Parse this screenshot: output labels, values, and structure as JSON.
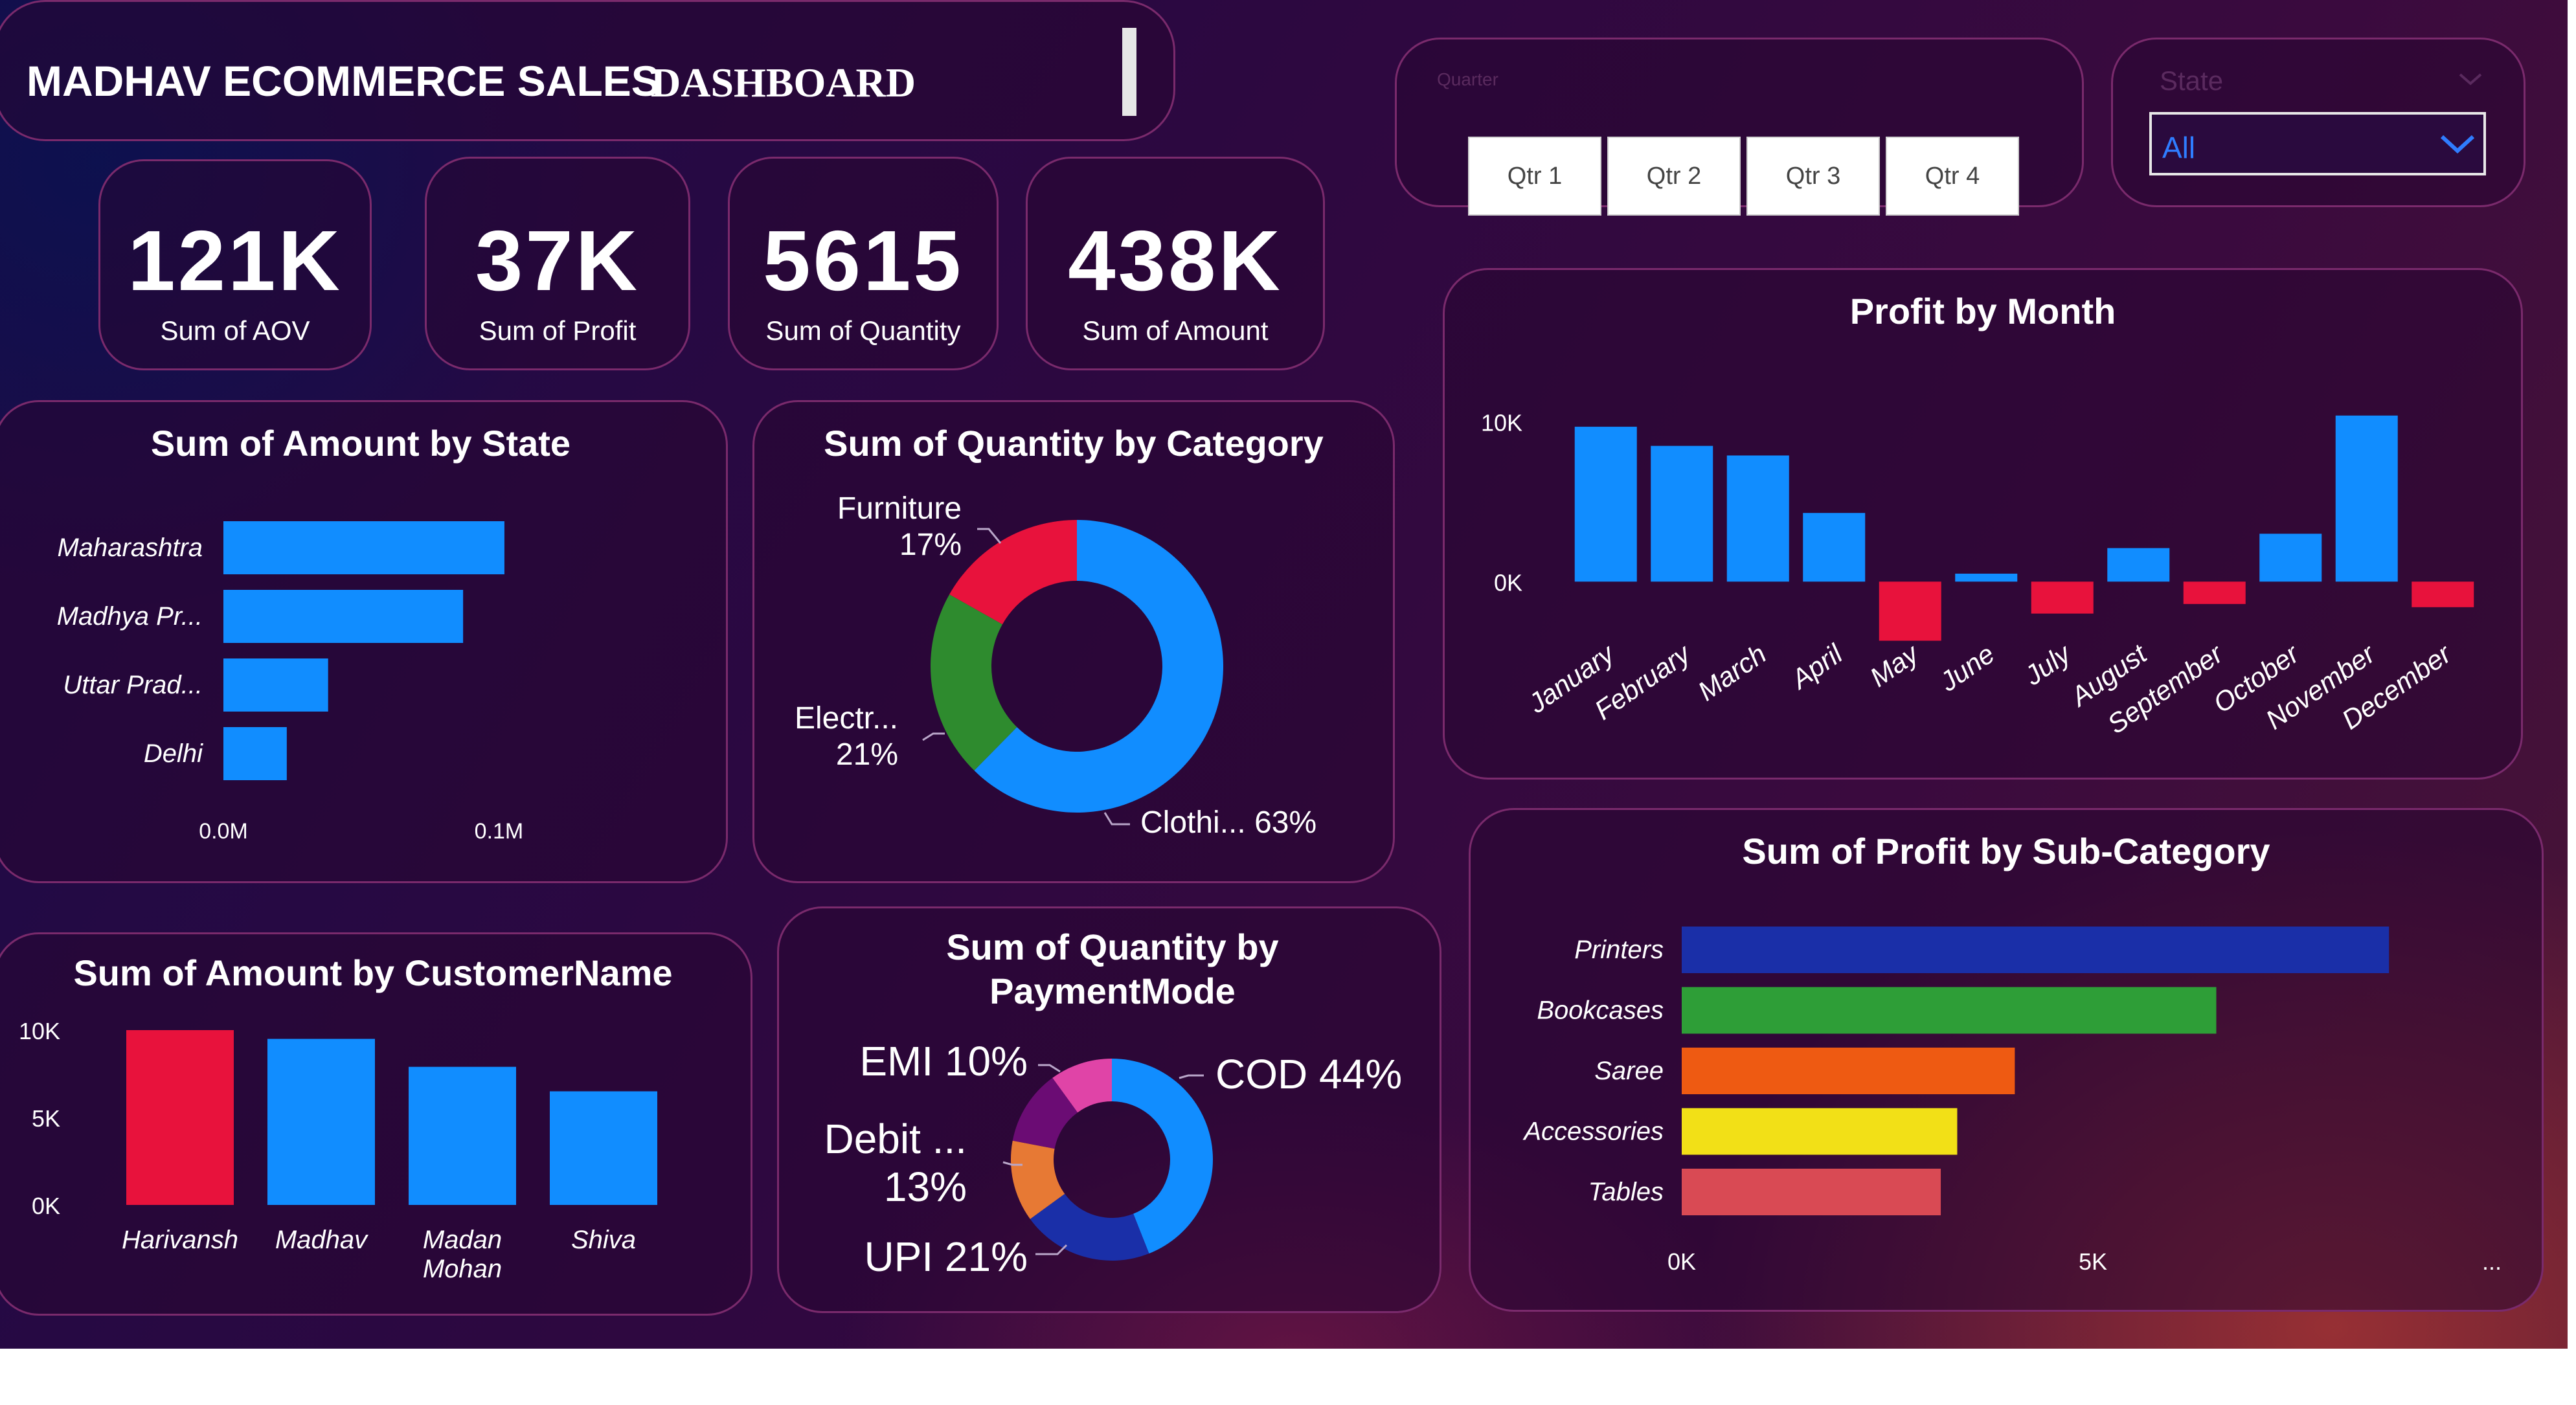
{
  "header": {
    "title_bold": "MADHAV ECOMMERCE SALES",
    "title_serif": "DASHBOARD"
  },
  "kpis": [
    {
      "value": "121K",
      "label": "Sum of AOV"
    },
    {
      "value": "37K",
      "label": "Sum of Profit"
    },
    {
      "value": "5615",
      "label": "Sum of Quantity"
    },
    {
      "value": "438K",
      "label": "Sum of Amount"
    }
  ],
  "quarter_slicer": {
    "label": "Quarter",
    "options": [
      "Qtr 1",
      "Qtr 2",
      "Qtr 3",
      "Qtr 4"
    ]
  },
  "state_slicer": {
    "label": "State",
    "selected": "All"
  },
  "colors": {
    "blue": "#118dff",
    "red": "#e8123c",
    "green": "#2e8b2e",
    "navy": "#1a2fa8",
    "orange": "#ee5a12",
    "yellow": "#f2e017",
    "rose": "#d94a54",
    "pink": "#e044a7",
    "purple": "#6b0c74",
    "amber": "#e77934"
  },
  "chart_data": [
    {
      "id": "amount_by_state",
      "type": "bar",
      "orientation": "horizontal",
      "title": "Sum of Amount by State",
      "categories": [
        "Maharashtra",
        "Madhya Pr...",
        "Uttar Prad...",
        "Delhi"
      ],
      "values": [
        0.102,
        0.087,
        0.038,
        0.023
      ],
      "unit": "M",
      "xlim": [
        0,
        0.11
      ],
      "ticks": [
        {
          "value": 0,
          "label": "0.0M"
        },
        {
          "value": 0.1,
          "label": "0.1M"
        }
      ]
    },
    {
      "id": "quantity_by_category",
      "type": "pie",
      "donut": true,
      "title": "Sum of Quantity by Category",
      "slices": [
        {
          "label": "Clothi...",
          "pct": "63%",
          "value": 63,
          "color": "#118dff"
        },
        {
          "label": "Electr...",
          "pct": "21%",
          "value": 21,
          "color": "#2e8b2e"
        },
        {
          "label": "Furniture",
          "pct": "17%",
          "value": 17,
          "color": "#e8123c"
        }
      ]
    },
    {
      "id": "profit_by_month",
      "type": "bar",
      "title": "Profit by Month",
      "categories": [
        "January",
        "February",
        "March",
        "April",
        "May",
        "June",
        "July",
        "August",
        "September",
        "October",
        "November",
        "December"
      ],
      "values": [
        9700,
        8500,
        7900,
        4300,
        -3700,
        500,
        -2000,
        2100,
        -1400,
        3000,
        10400,
        -1600
      ],
      "ylim": [
        -4000,
        11000
      ],
      "ticks": [
        {
          "value": 0,
          "label": "0K"
        },
        {
          "value": 10000,
          "label": "10K"
        }
      ]
    },
    {
      "id": "amount_by_customer",
      "type": "bar",
      "title": "Sum of Amount by CustomerName",
      "categories": [
        "Harivansh",
        "Madhav",
        "Madan Mohan",
        "Shiva"
      ],
      "values": [
        10000,
        9500,
        7900,
        6500
      ],
      "highlight_index": 0,
      "ylim": [
        0,
        10000
      ],
      "ticks": [
        {
          "value": 0,
          "label": "0K"
        },
        {
          "value": 5000,
          "label": "5K"
        },
        {
          "value": 10000,
          "label": "10K"
        }
      ]
    },
    {
      "id": "quantity_by_paymentmode",
      "type": "pie",
      "donut": true,
      "title": "Sum of Quantity by PaymentMode",
      "slices": [
        {
          "label": "COD",
          "pct": "44%",
          "value": 44,
          "color": "#118dff"
        },
        {
          "label": "UPI",
          "pct": "21%",
          "value": 21,
          "color": "#1a2fa8"
        },
        {
          "label": "Debit ...",
          "pct": "13%",
          "value": 13,
          "color": "#e77934"
        },
        {
          "label": "",
          "pct": "",
          "value": 12,
          "color": "#6b0c74"
        },
        {
          "label": "EMI",
          "pct": "10%",
          "value": 10,
          "color": "#e044a7"
        }
      ]
    },
    {
      "id": "profit_by_subcategory",
      "type": "bar",
      "orientation": "horizontal",
      "title": "Sum of Profit by Sub-Category",
      "categories": [
        "Printers",
        "Bookcases",
        "Saree",
        "Accessories",
        "Tables"
      ],
      "values": [
        8600,
        6500,
        4050,
        3350,
        3150
      ],
      "colors": [
        "#1a2fa8",
        "#2e9e37",
        "#ee5a12",
        "#f2e017",
        "#d94a54"
      ],
      "xlim": [
        0,
        10000
      ],
      "ticks": [
        {
          "value": 0,
          "label": "0K"
        },
        {
          "value": 5000,
          "label": "5K"
        }
      ],
      "more_label": "..."
    }
  ]
}
